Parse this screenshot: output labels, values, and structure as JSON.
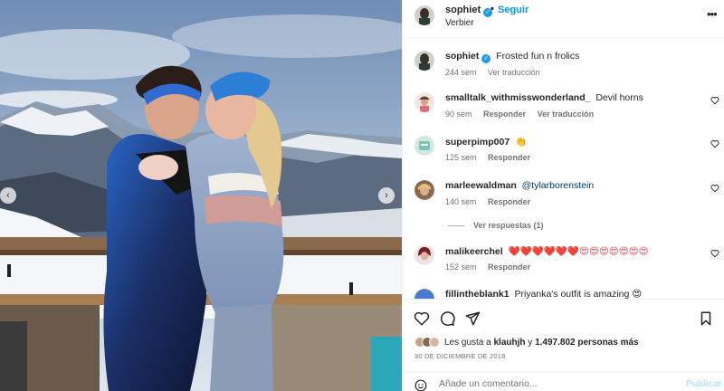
{
  "colors": {
    "accent": "#0095f6",
    "verified": "#1d9bf0",
    "heart_red": "#ed4956"
  },
  "header": {
    "username": "sophiet",
    "follow_label": "Seguir",
    "separator": "•",
    "subtitle": "Verbier",
    "more_icon": "more-horizontal-icon"
  },
  "caption": {
    "username": "sophiet",
    "text": "Frosted fun n frolics",
    "time": "244 sem",
    "translate": "Ver traducción"
  },
  "comments": [
    {
      "username": "smalltalk_withmisswonderland_",
      "text": "Devil horns",
      "time": "90 sem",
      "reply": "Responder",
      "translate": "Ver traducción"
    },
    {
      "username": "superpimp007",
      "text": "👏",
      "time": "125 sem",
      "reply": "Responder"
    },
    {
      "username": "marleewaldman",
      "text": "@tylarborenstein",
      "time": "140 sem",
      "reply": "Responder"
    },
    {
      "username": "malikeerchel",
      "text": "❤️❤️❤️❤️❤️❤️😍😍😍😍😍😍😍",
      "time": "152 sem",
      "reply": "Responder"
    },
    {
      "username": "fillintheblank1",
      "text": "Priyanka's outfit is amazing 😍"
    }
  ],
  "view_replies": "Ver respuestas (1)",
  "actions": {
    "like_icon": "heart-icon",
    "comment_icon": "comment-icon",
    "share_icon": "send-icon",
    "save_icon": "bookmark-icon"
  },
  "likes": {
    "prefix": "Les gusta a",
    "user": "klauhjh",
    "connector": "y",
    "count": "1.497.802 personas más"
  },
  "date": "30 DE DICIEMBRE DE 2018",
  "comment_box": {
    "placeholder": "Añade un comentario...",
    "publish": "Publicar"
  }
}
